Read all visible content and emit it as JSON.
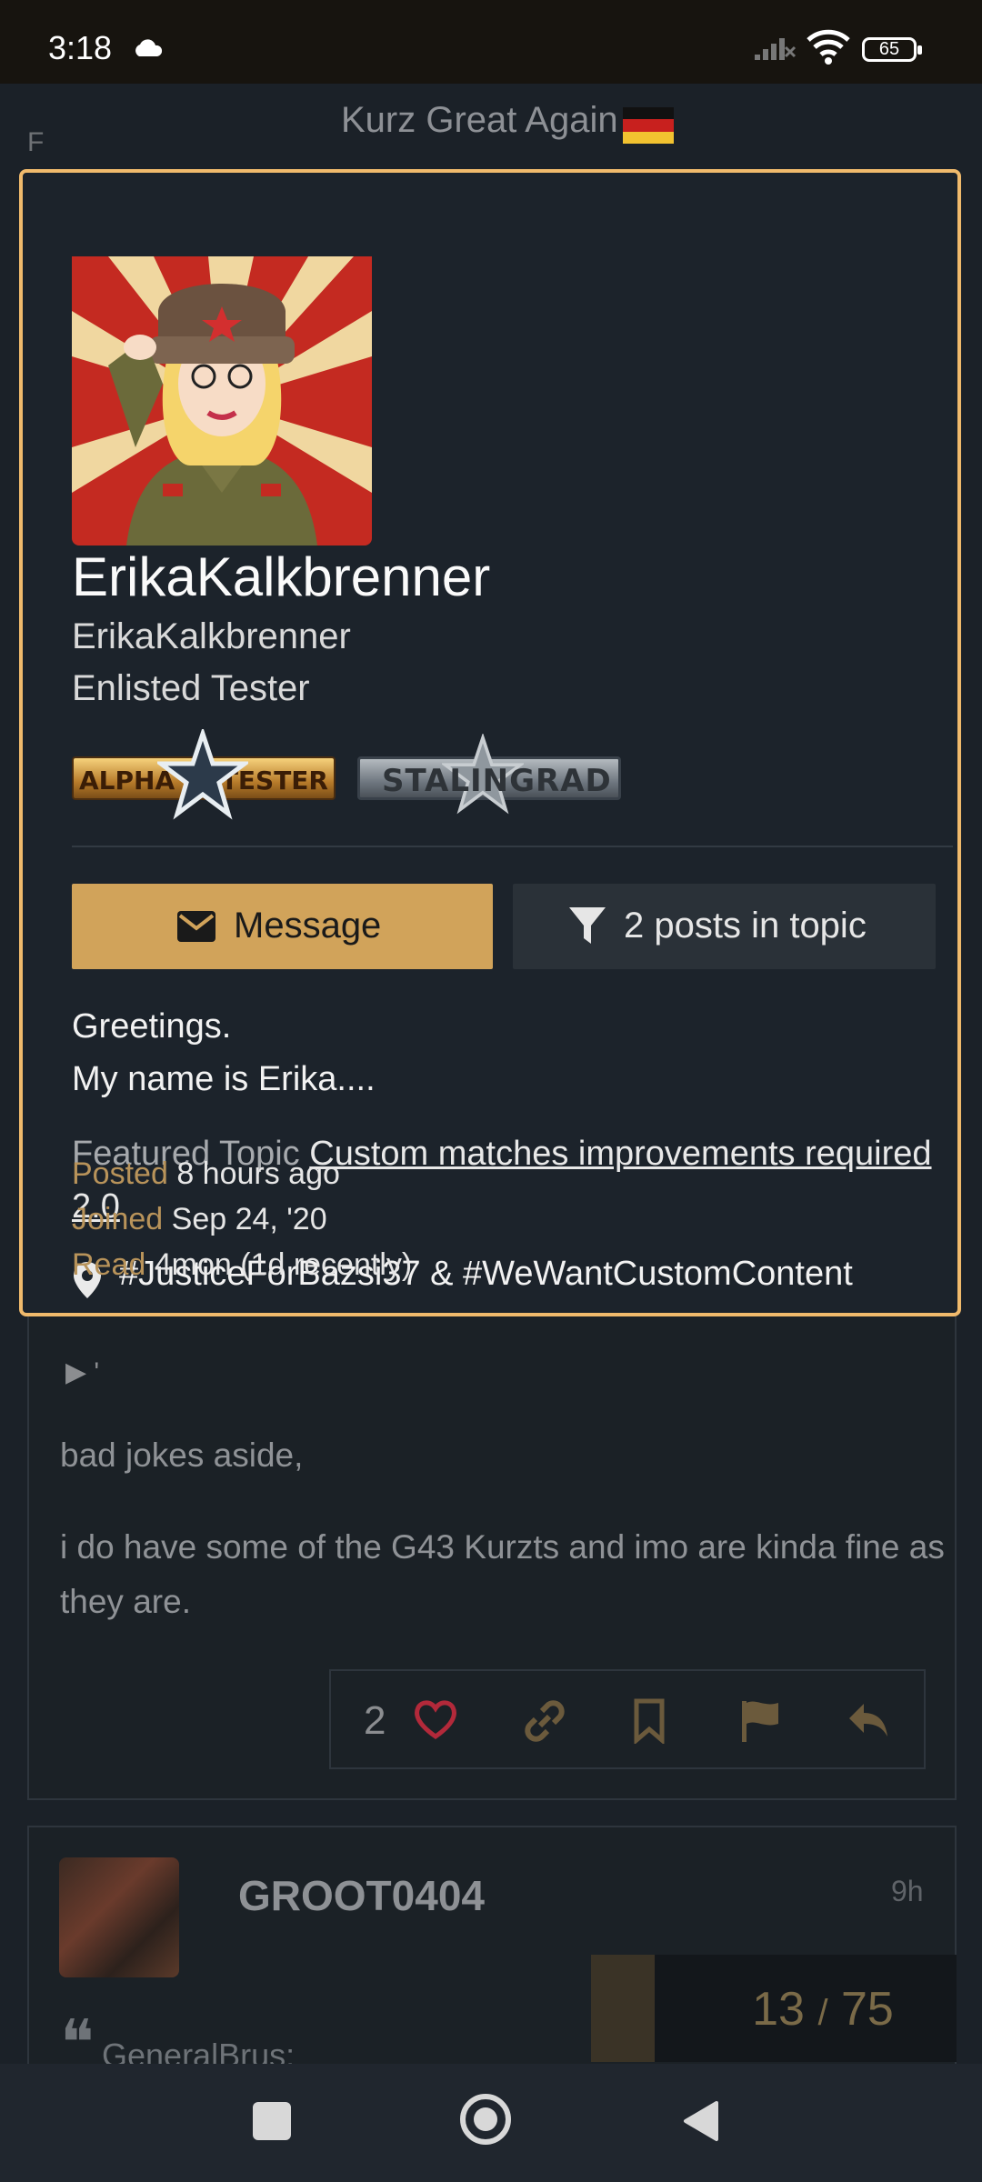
{
  "status_bar": {
    "time": "3:18",
    "battery": "65"
  },
  "topic": {
    "title": "Kurz Great Again",
    "left_letter": "F"
  },
  "user_card": {
    "display_name": "ErikaKalkbrenner",
    "username": "ErikaKalkbrenner",
    "title": "Enlisted Tester",
    "badges": [
      {
        "left": "ALPHA",
        "right": "TESTER"
      },
      {
        "label": "STALINGRAD"
      }
    ],
    "message_button": "Message",
    "filter_button": "2 posts in topic",
    "bio_line1": "Greetings.",
    "bio_line2": "My name is Erika....",
    "featured_label": "Featured Topic",
    "featured_link": "Custom matches improvements required 2.0",
    "location": "#JusticeForBazsi37 & #WeWantCustomContent",
    "posted_label": "Posted",
    "posted_value": "8 hours ago",
    "joined_label": "Joined",
    "joined_value": "Sep 24, '20",
    "read_label": "Read",
    "read_value": "4mon (1d recently)",
    "accent_color": "#f0ba6c"
  },
  "post": {
    "toggle_text": "'",
    "paragraph1": "bad jokes aside,",
    "paragraph2": "i do have some of the G43 Kurzts and imo are kinda fine as they are.",
    "like_count": "2"
  },
  "next_post": {
    "username": "GROOT0404",
    "time": "9h",
    "quote_author": "GeneralBrus:"
  },
  "progress": {
    "current": "13",
    "separator": "/",
    "total": "75",
    "fraction": 0.173
  }
}
